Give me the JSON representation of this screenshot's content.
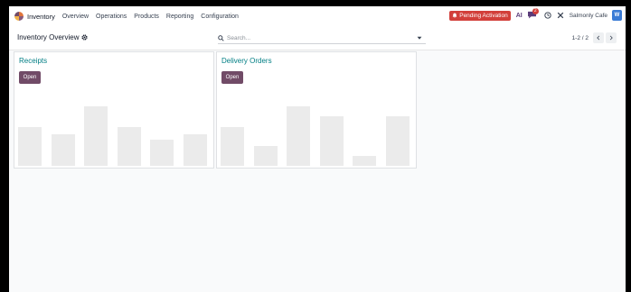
{
  "navbar": {
    "app_name": "Inventory",
    "menu": [
      "Overview",
      "Operations",
      "Products",
      "Reporting",
      "Configuration"
    ],
    "pending_label": "Pending Activation",
    "ai_label": "AI",
    "message_count": "2",
    "company": "Salmonly Cafe",
    "avatar_initial": "W"
  },
  "control": {
    "breadcrumb": "Inventory Overview",
    "search_placeholder": "Search...",
    "pager_value": "1-2 / 2"
  },
  "cards": [
    {
      "title": "Receipts",
      "button": "Open",
      "bars": [
        0.6,
        0.49,
        0.92,
        0.6,
        0.4,
        0.49
      ]
    },
    {
      "title": "Delivery Orders",
      "button": "Open",
      "bars": [
        0.6,
        0.3,
        0.92,
        0.76,
        0.15,
        0.76
      ]
    }
  ],
  "colors": {
    "brand": "#714b67",
    "title": "#017e84",
    "alert": "#d23f3a",
    "placeholder_bar": "#ebebeb"
  }
}
